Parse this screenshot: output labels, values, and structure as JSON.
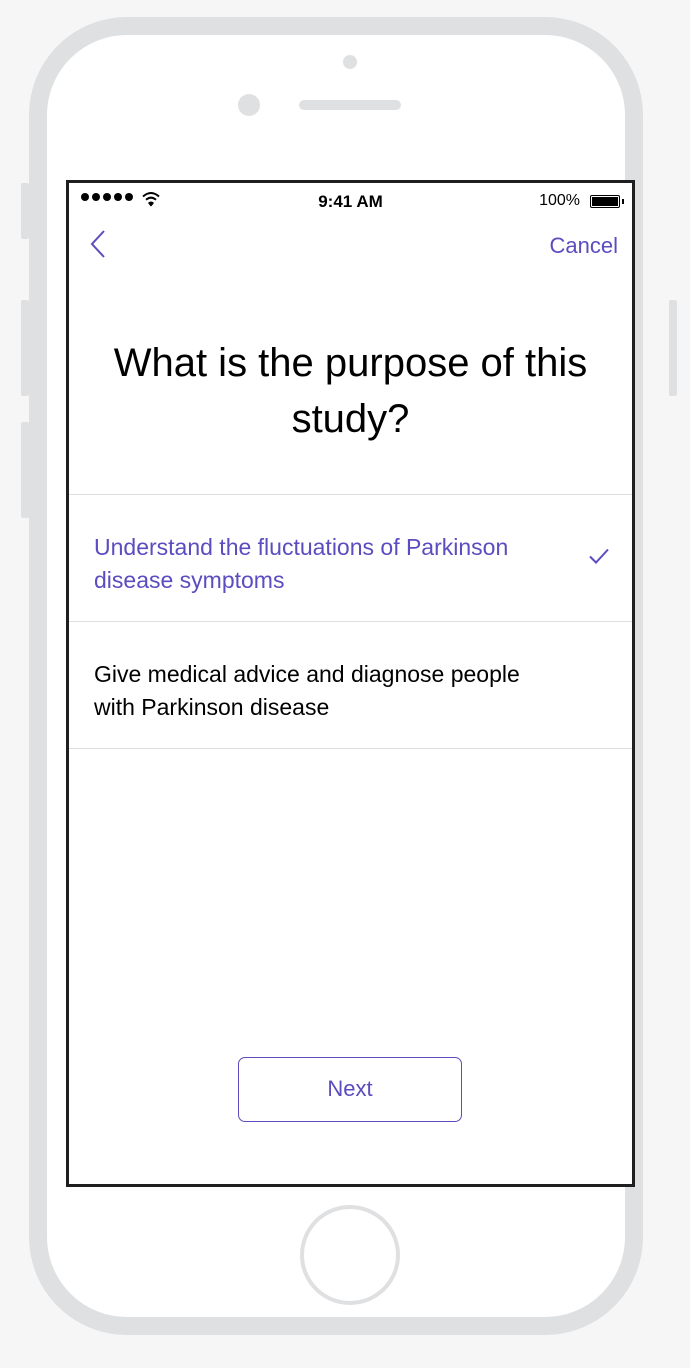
{
  "status_bar": {
    "time": "9:41 AM",
    "battery_percent": "100%",
    "signal_bars": 5,
    "icons": [
      "signal-icon",
      "wifi-icon",
      "battery-icon"
    ]
  },
  "nav": {
    "back_icon": "chevron-left-icon",
    "cancel_label": "Cancel"
  },
  "question": "What is the purpose of this study?",
  "options": [
    {
      "label": "Understand the fluctuations of Parkinson disease symptoms",
      "selected": true
    },
    {
      "label": "Give medical advice and diagnose people with Parkinson disease",
      "selected": false
    }
  ],
  "next_label": "Next",
  "colors": {
    "accent": "#5b4cbf",
    "frame": "#dfe0e2",
    "divider": "#dedede",
    "text": "#000000"
  }
}
